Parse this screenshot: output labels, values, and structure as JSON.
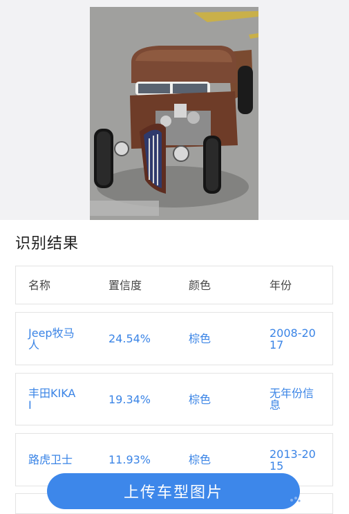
{
  "result_title": "识别结果",
  "table": {
    "headers": [
      "名称",
      "置信度",
      "颜色",
      "年份"
    ],
    "rows": [
      [
        "Jeep牧马人",
        "24.54%",
        "棕色",
        "2008-2017"
      ],
      [
        "丰田KIKAI",
        "19.34%",
        "棕色",
        "无年份信息"
      ],
      [
        "路虎卫士",
        "11.93%",
        "棕色",
        "2013-2015"
      ]
    ]
  },
  "upload_button_label": "上传车型图片",
  "colors": {
    "accent": "#3d87ea",
    "link_text": "#3a84e6",
    "background_top": "#f2f2f4"
  }
}
